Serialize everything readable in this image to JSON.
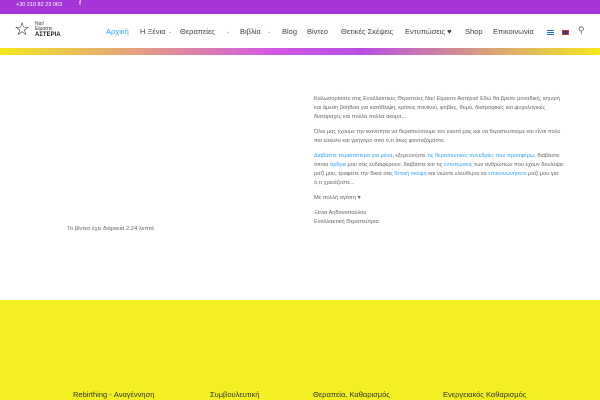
{
  "topbar": {
    "phone": "+30 210 82 23 063",
    "social_icon": "f"
  },
  "logo": {
    "line1": "Ναι!",
    "line2": "Είμαστε",
    "line3": "ΑΣΤΕΡΙΑ",
    "icon": "star-icon"
  },
  "nav": {
    "home": "Αρχική",
    "xenia": "Η Ξένια",
    "therapies": "Θεραπείες",
    "books": "Βιβλία",
    "blog": "Blog",
    "video": "Βίντεο",
    "positive": "Θετικές Σκέψεις",
    "impressions": "Εντυπώσεις ♥",
    "shop": "Shop",
    "contact": "Επικοινωνία",
    "search_icon": "⚲"
  },
  "video_note": "Το βίντεο έχει διάρκεια 2.24 λεπτά",
  "intro": {
    "p1": "Καλωσορίσατε στις Εναλλακτικές Θεραπείες Ναι! Είμαστε Αστέρια! Εδώ θα βρείτε μοναδική, ισχυρή και άμεση βοήθεια για κατάθλιψη, κρίσεις πανικού, φοβίες, θυμό, διατροφικές και ψυχολογικές διαταραχές και πολλά πολλά ακόμα...",
    "p2": "Όλοι μας έχουμε την ικανότητα να θεραπεύσουμε τον εαυτό μας και να θεραπευτούμε και είναι πολύ πιο εύκολο και γρήγορο από ό,τι ίσως φανταζόμαστε.",
    "p3_link1": "Διαβάστε περισσότερα για μένα",
    "p3_t1": ", εξερευνήστε ",
    "p3_link2": "τις θεραπευτικές συνεδρίες που προσφέρω",
    "p3_t2": ", διαβάστε όποια ",
    "p3_link3": "άρθρα",
    "p3_t3": " μου σας ενδιαφέρουν, διαβάστε και τις ",
    "p3_link4": "εντυπώσεις",
    "p3_t4": " των ανθρώπων που έχουν δουλέψει μαζί μου, τραφείτε την δικιά σας ",
    "p3_link5": "θετική σκέψη",
    "p3_t5": " και νιώστε ελεύθεροι να ",
    "p3_link6": "επικοινωνήσετε",
    "p3_t6": " μαζί μου για ό,τι χρειάζεστε...",
    "p4": "Με πολλή αγάπη ♥",
    "sig1": "Ξένια Αηδονοπούλου",
    "sig2": "Εναλλακτική Θεραπεύτρια"
  },
  "footer": {
    "col1": "Rebirthing - Αναγέννηση",
    "col2": "Συμβουλευτική",
    "col3": "Θεραπεία, Καθαρισμός",
    "col4": "Ενεργειακός Καθαρισμός"
  }
}
